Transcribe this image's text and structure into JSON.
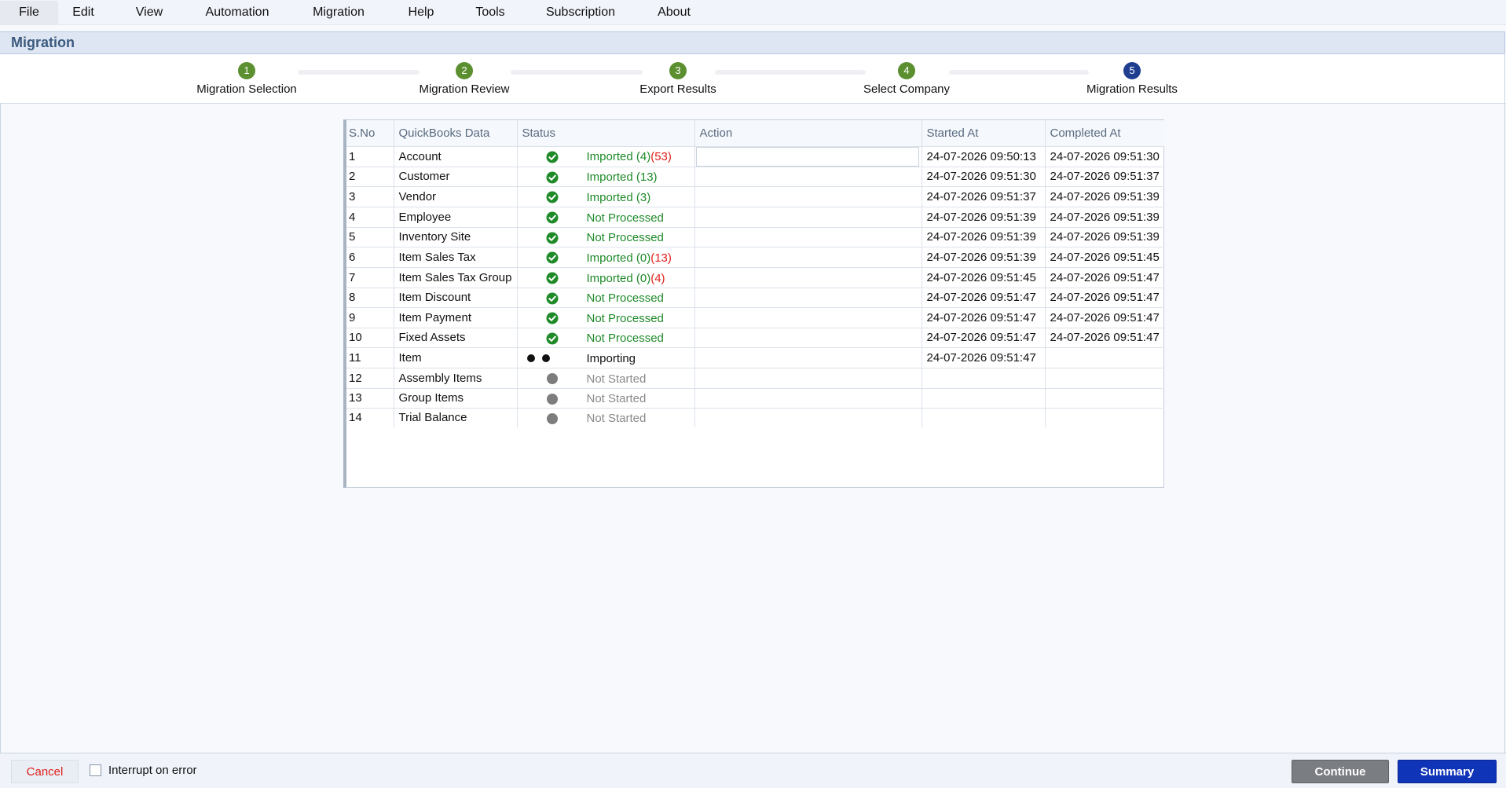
{
  "menu": {
    "items": [
      "File",
      "Edit",
      "View",
      "Automation",
      "Migration",
      "Help",
      "Tools",
      "Subscription",
      "About"
    ]
  },
  "page": {
    "title": "Migration"
  },
  "stepper": {
    "steps": [
      {
        "number": "1",
        "label": "Migration Selection",
        "state": "done"
      },
      {
        "number": "2",
        "label": "Migration Review",
        "state": "done"
      },
      {
        "number": "3",
        "label": "Export Results",
        "state": "done"
      },
      {
        "number": "4",
        "label": "Select Company",
        "state": "done"
      },
      {
        "number": "5",
        "label": "Migration Results",
        "state": "current"
      }
    ]
  },
  "colors": {
    "done": "#5b8f2f",
    "current": "#1f3e8f",
    "status_ok": "#1e8a28",
    "status_error": "#e0201b",
    "status_pending": "#8a8a8a"
  },
  "table": {
    "headers": [
      "S.No",
      "QuickBooks Data",
      "Status",
      "Action",
      "Started At",
      "Completed At"
    ],
    "rows": [
      {
        "sno": "1",
        "data": "Account",
        "icon": "check-circle-icon",
        "status": "Imported (4)",
        "status_extra": "(53)",
        "status_color": "green",
        "started": "24-07-2026 09:50:13",
        "completed": "24-07-2026 09:51:30"
      },
      {
        "sno": "2",
        "data": "Customer",
        "icon": "check-circle-icon",
        "status": "Imported (13)",
        "status_extra": "",
        "status_color": "green",
        "started": "24-07-2026 09:51:30",
        "completed": "24-07-2026 09:51:37"
      },
      {
        "sno": "3",
        "data": "Vendor",
        "icon": "check-circle-icon",
        "status": "Imported (3)",
        "status_extra": "",
        "status_color": "green",
        "started": "24-07-2026 09:51:37",
        "completed": "24-07-2026 09:51:39"
      },
      {
        "sno": "4",
        "data": "Employee",
        "icon": "check-circle-icon",
        "status": "Not Processed",
        "status_extra": "",
        "status_color": "green",
        "started": "24-07-2026 09:51:39",
        "completed": "24-07-2026 09:51:39"
      },
      {
        "sno": "5",
        "data": "Inventory Site",
        "icon": "check-circle-icon",
        "status": "Not Processed",
        "status_extra": "",
        "status_color": "green",
        "started": "24-07-2026 09:51:39",
        "completed": "24-07-2026 09:51:39"
      },
      {
        "sno": "6",
        "data": "Item Sales Tax",
        "icon": "check-circle-icon",
        "status": "Imported (0)",
        "status_extra": "(13)",
        "status_color": "green",
        "started": "24-07-2026 09:51:39",
        "completed": "24-07-2026 09:51:45"
      },
      {
        "sno": "7",
        "data": "Item Sales Tax Group",
        "icon": "check-circle-icon",
        "status": "Imported (0)",
        "status_extra": "(4)",
        "status_color": "green",
        "started": "24-07-2026 09:51:45",
        "completed": "24-07-2026 09:51:47"
      },
      {
        "sno": "8",
        "data": "Item Discount",
        "icon": "check-circle-icon",
        "status": "Not Processed",
        "status_extra": "",
        "status_color": "green",
        "started": "24-07-2026 09:51:47",
        "completed": "24-07-2026 09:51:47"
      },
      {
        "sno": "9",
        "data": "Item Payment",
        "icon": "check-circle-icon",
        "status": "Not Processed",
        "status_extra": "",
        "status_color": "green",
        "started": "24-07-2026 09:51:47",
        "completed": "24-07-2026 09:51:47"
      },
      {
        "sno": "10",
        "data": "Fixed Assets",
        "icon": "check-circle-icon",
        "status": "Not Processed",
        "status_extra": "",
        "status_color": "green",
        "started": "24-07-2026 09:51:47",
        "completed": "24-07-2026 09:51:47"
      },
      {
        "sno": "11",
        "data": "Item",
        "icon": "loading-dots-icon",
        "status": "Importing",
        "status_extra": "",
        "status_color": "black",
        "started": "24-07-2026 09:51:47",
        "completed": ""
      },
      {
        "sno": "12",
        "data": "Assembly Items",
        "icon": "pending-circle-icon",
        "status": "Not Started",
        "status_extra": "",
        "status_color": "grey",
        "started": "",
        "completed": ""
      },
      {
        "sno": "13",
        "data": "Group Items",
        "icon": "pending-circle-icon",
        "status": "Not Started",
        "status_extra": "",
        "status_color": "grey",
        "started": "",
        "completed": ""
      },
      {
        "sno": "14",
        "data": "Trial Balance",
        "icon": "pending-circle-icon",
        "status": "Not Started",
        "status_extra": "",
        "status_color": "grey",
        "started": "",
        "completed": ""
      }
    ]
  },
  "footer": {
    "cancel_label": "Cancel",
    "interrupt_label": "Interrupt on error",
    "interrupt_checked": false,
    "continue_label": "Continue",
    "summary_label": "Summary"
  }
}
